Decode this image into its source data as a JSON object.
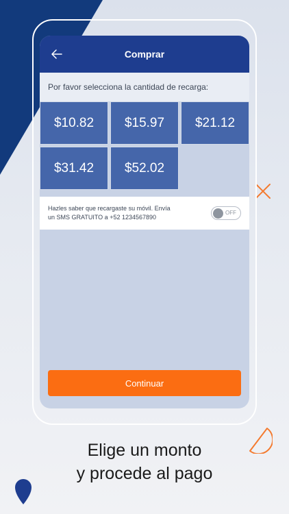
{
  "colors": {
    "header_bg": "#1e3d8f",
    "tile_bg": "#4566aa",
    "accent_orange": "#fb6d12",
    "brand_navy": "#123a7c"
  },
  "header": {
    "back_icon": "arrow-left-icon",
    "title": "Comprar"
  },
  "prompt": "Por favor selecciona la cantidad de recarga:",
  "amounts": [
    "$10.82",
    "$15.97",
    "$21.12",
    "$31.42",
    "$52.02"
  ],
  "sms": {
    "line1": "Hazles saber que recargaste su móvil. Envía",
    "line2": "un SMS GRATUITO a +52 1234567890",
    "toggle_label": "OFF",
    "toggle_on": false
  },
  "continue_label": "Continuar",
  "caption": {
    "line1": "Elige un monto",
    "line2": "y procede al pago"
  }
}
